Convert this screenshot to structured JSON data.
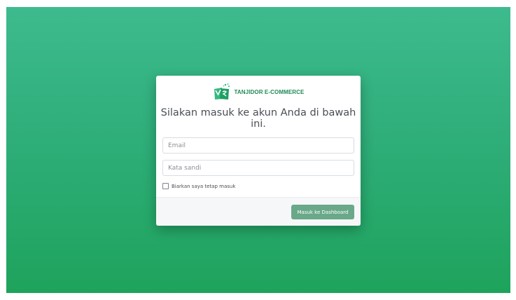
{
  "brand": {
    "name": "TANJIDOR E-COMMERCE",
    "logo_icon": "shopping-bag-icon",
    "brand_color": "#1f8a56"
  },
  "login": {
    "heading": "Silakan masuk ke akun Anda di bawah ini.",
    "email_placeholder": "Email",
    "email_value": "",
    "password_placeholder": "Kata sandi",
    "password_value": "",
    "remember_label": "Biarkan saya tetap masuk",
    "remember_checked": false,
    "submit_label": "Masuk ke Dashboard"
  },
  "colors": {
    "background_top": "#3dbb8e",
    "background_bottom": "#1ea35c",
    "button": "#69a889"
  }
}
